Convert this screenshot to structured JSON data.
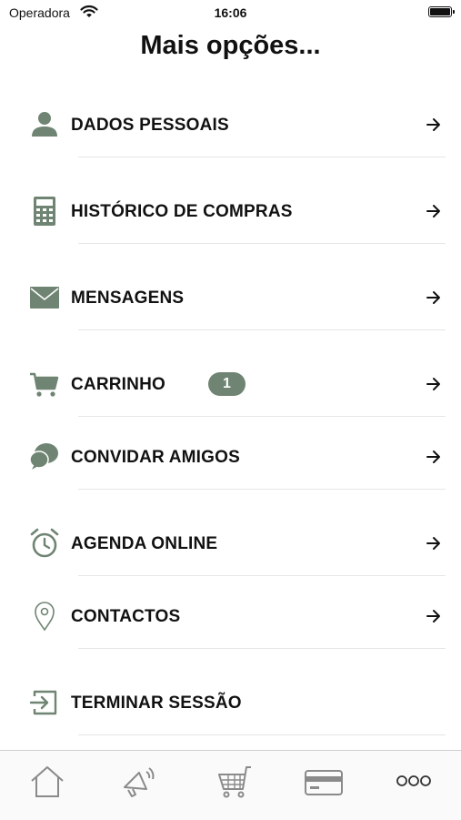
{
  "status_bar": {
    "carrier": "Operadora",
    "time": "16:06"
  },
  "page": {
    "title": "Mais opções..."
  },
  "colors": {
    "icon_green": "#6f8472",
    "badge_green": "#6f8472",
    "tab_gray": "#8a8a8a"
  },
  "menu": {
    "items": [
      {
        "label": "DADOS PESSOAIS",
        "icon": "person-icon"
      },
      {
        "label": "HISTÓRICO DE COMPRAS",
        "icon": "calculator-icon"
      },
      {
        "label": "MENSAGENS",
        "icon": "envelope-icon"
      },
      {
        "label": "CARRINHO",
        "icon": "cart-icon",
        "badge": "1"
      },
      {
        "label": "CONVIDAR AMIGOS",
        "icon": "chat-bubbles-icon"
      },
      {
        "label": "AGENDA ONLINE",
        "icon": "alarm-clock-icon"
      },
      {
        "label": "CONTACTOS",
        "icon": "location-pin-icon"
      },
      {
        "label": "TERMINAR SESSÃO",
        "icon": "logout-icon"
      }
    ]
  },
  "tabbar": {
    "tabs": [
      {
        "icon": "home-icon"
      },
      {
        "icon": "megaphone-icon"
      },
      {
        "icon": "shopping-cart-icon"
      },
      {
        "icon": "credit-card-icon"
      },
      {
        "icon": "more-icon"
      }
    ]
  }
}
